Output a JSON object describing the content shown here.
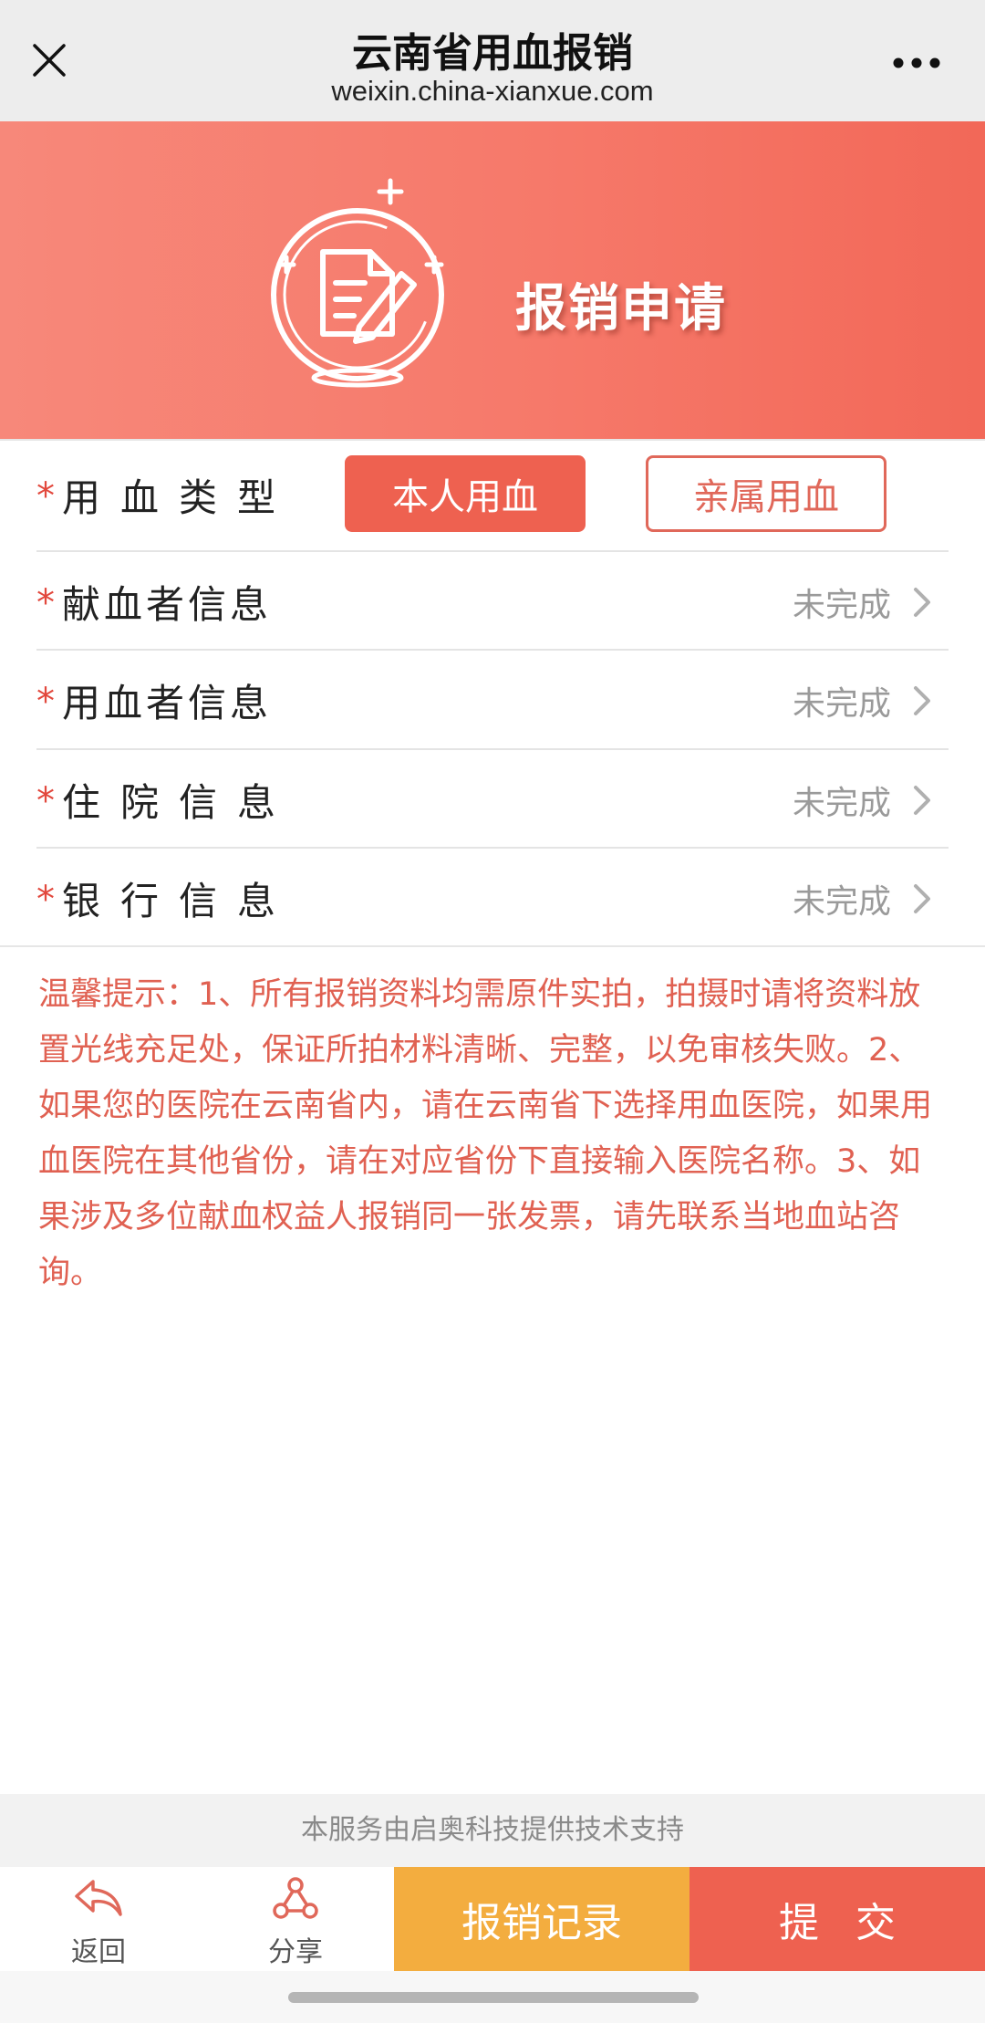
{
  "nav": {
    "title": "云南省用血报销",
    "url": "weixin.china-xianxue.com",
    "close_icon": "close-icon",
    "more_icon": "more-dots-icon"
  },
  "banner": {
    "title": "报销申请",
    "icon": "document-edit-icon"
  },
  "form": {
    "required_mark": "*",
    "blood_type": {
      "label": "用血类型",
      "options": [
        "本人用血",
        "亲属用血"
      ],
      "selected": "本人用血"
    },
    "rows": [
      {
        "label": "献血者信息",
        "status": "未完成"
      },
      {
        "label": "用血者信息",
        "status": "未完成"
      },
      {
        "label": "住院信息",
        "status": "未完成"
      },
      {
        "label": "银行信息",
        "status": "未完成"
      }
    ]
  },
  "notice": "温馨提示：1、所有报销资料均需原件实拍，拍摄时请将资料放置光线充足处，保证所拍材料清晰、完整，以免审核失败。2、如果您的医院在云南省内，请在云南省下选择用血医院，如果用血医院在其他省份，请在对应省份下直接输入医院名称。3、如果涉及多位献血权益人报销同一张发票，请先联系当地血站咨询。",
  "footer": {
    "support": "本服务由启奥科技提供技术支持",
    "back_label": "返回",
    "share_label": "分享",
    "records_label": "报销记录",
    "submit_label": "提交"
  },
  "colors": {
    "primary": "#ee6150",
    "accent": "#f3ad3f",
    "notice": "#e06152"
  }
}
